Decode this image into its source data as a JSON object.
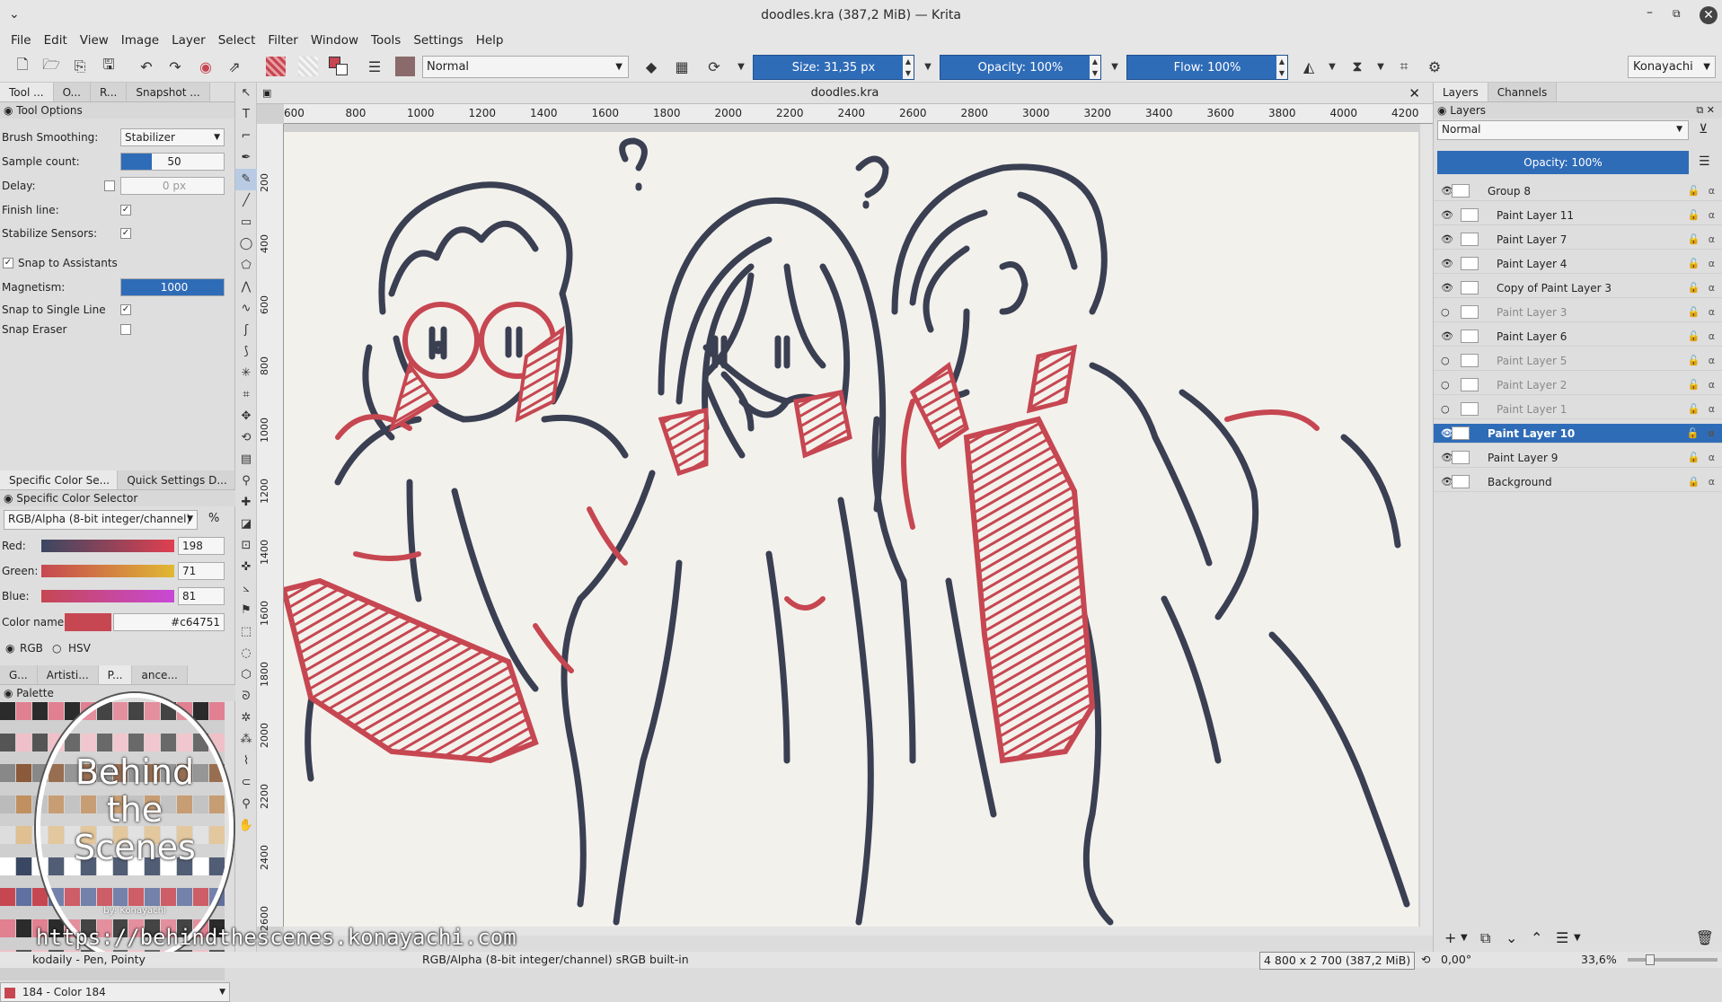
{
  "window": {
    "title": "doodles.kra (387,2 MiB) — Krita"
  },
  "menu": [
    "File",
    "Edit",
    "View",
    "Image",
    "Layer",
    "Select",
    "Filter",
    "Window",
    "Tools",
    "Settings",
    "Help"
  ],
  "toolbar": {
    "blend_mode": "Normal",
    "size": "Size: 31,35 px",
    "opacity": "Opacity: 100%",
    "flow": "Flow: 100%",
    "workspace": "Konayachi"
  },
  "left_dock": {
    "tabs": [
      "Tool ...",
      "O...",
      "R...",
      "Snapshot ..."
    ],
    "tool_options_title": "Tool Options",
    "brush_smoothing_label": "Brush Smoothing:",
    "brush_smoothing_value": "Stabilizer",
    "sample_count_label": "Sample count:",
    "sample_count_value": "50",
    "delay_label": "Delay:",
    "delay_value": "0 px",
    "finish_line_label": "Finish line:",
    "stabilize_sensors_label": "Stabilize Sensors:",
    "snap_to_assistants_label": "Snap to Assistants",
    "magnetism_label": "Magnetism:",
    "magnetism_value": "1000",
    "snap_single_line_label": "Snap to Single Line",
    "snap_eraser_label": "Snap Eraser",
    "color_tabs": [
      "Specific Color Se...",
      "Quick Settings D..."
    ],
    "color_title": "Specific Color Selector",
    "color_model": "RGB/Alpha (8-bit integer/channel)",
    "red_label": "Red:",
    "red_value": "198",
    "green_label": "Green:",
    "green_value": "71",
    "blue_label": "Blue:",
    "blue_value": "81",
    "color_name_label": "Color name:",
    "color_hex": "#c64751",
    "rgb_label": "RGB",
    "hsv_label": "HSV",
    "bottom_tabs": [
      "G...",
      "Artisti...",
      "P...",
      "ance..."
    ],
    "palette_title": "Palette",
    "palette_current": "184 - Color 184",
    "watermark_line1": "Behind",
    "watermark_line2": "the",
    "watermark_line3": "Scenes",
    "watermark_by": "by: Konayachi"
  },
  "document": {
    "tab_title": "doodles.kra",
    "ruler_top": [
      "600",
      "800",
      "1000",
      "1200",
      "1400",
      "1600",
      "1800",
      "2000",
      "2200",
      "2400",
      "2600",
      "2800",
      "3000",
      "3200",
      "3400",
      "3600",
      "3800",
      "4000",
      "4200"
    ],
    "ruler_left": [
      "200",
      "400",
      "600",
      "800",
      "1000",
      "1200",
      "1400",
      "1600",
      "1800",
      "2000",
      "2200",
      "2400",
      "2600"
    ]
  },
  "right_dock": {
    "tabs": [
      "Layers",
      "Channels"
    ],
    "title": "Layers",
    "blend_mode": "Normal",
    "opacity": "Opacity:  100%",
    "layers": [
      {
        "name": "Group 8",
        "visible": true,
        "selected": false,
        "dim": false,
        "indent": false
      },
      {
        "name": "Paint Layer 11",
        "visible": true,
        "selected": false,
        "dim": false,
        "indent": true
      },
      {
        "name": "Paint Layer 7",
        "visible": true,
        "selected": false,
        "dim": false,
        "indent": true
      },
      {
        "name": "Paint Layer 4",
        "visible": true,
        "selected": false,
        "dim": false,
        "indent": true
      },
      {
        "name": "Copy of Paint Layer 3",
        "visible": true,
        "selected": false,
        "dim": false,
        "indent": true
      },
      {
        "name": "Paint Layer 3",
        "visible": false,
        "selected": false,
        "dim": true,
        "indent": true
      },
      {
        "name": "Paint Layer 6",
        "visible": true,
        "selected": false,
        "dim": false,
        "indent": true
      },
      {
        "name": "Paint Layer 5",
        "visible": false,
        "selected": false,
        "dim": true,
        "indent": true
      },
      {
        "name": "Paint Layer 2",
        "visible": false,
        "selected": false,
        "dim": true,
        "indent": true
      },
      {
        "name": "Paint Layer 1",
        "visible": false,
        "selected": false,
        "dim": true,
        "indent": true
      },
      {
        "name": "Paint Layer 10",
        "visible": true,
        "selected": true,
        "dim": false,
        "indent": false
      },
      {
        "name": "Paint Layer 9",
        "visible": true,
        "selected": false,
        "dim": false,
        "indent": false
      },
      {
        "name": "Background",
        "visible": true,
        "selected": false,
        "dim": false,
        "indent": false
      }
    ]
  },
  "status": {
    "brush": "kodaily - Pen, Pointy",
    "color_space": "RGB/Alpha (8-bit integer/channel)  sRGB built-in",
    "image_size": "4 800 x 2 700 (387,2 MiB)",
    "rotation": "0,00°",
    "zoom": "33,6%"
  },
  "watermark_url": "https://behindthescenes.konayachi.com",
  "colors": {
    "accent": "#2f6cb8",
    "ink": "#3a3f52",
    "red": "#c64751",
    "canvas": "#f3f1ec"
  }
}
